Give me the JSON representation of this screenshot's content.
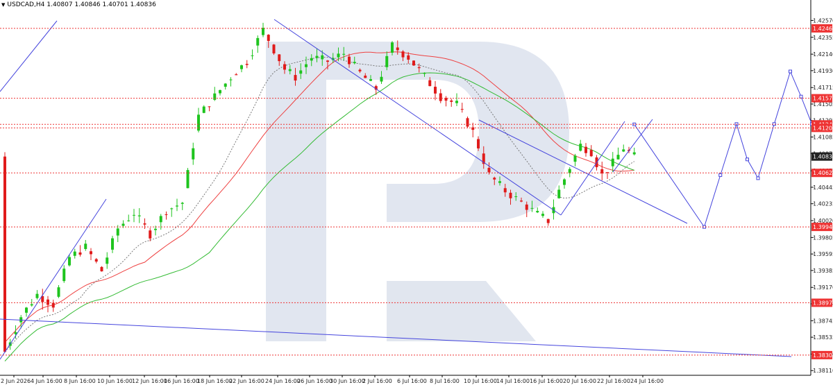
{
  "header": {
    "symbol": "USDCAD,H4",
    "ohlc": "1.40807 1.40846 1.40701 1.40836"
  },
  "colors": {
    "bull": "#1ec41e",
    "bear": "#e01b1b",
    "forecast": "#4444dd",
    "level": "#ee3333",
    "ma_slow": "#ee4040",
    "ma_mid": "#777777",
    "ma_fast": "#33bb33",
    "price_box": "#222222",
    "watermark": "#c9d2e3"
  },
  "chart_data": {
    "type": "candlestick",
    "ylim": [
      1.3805,
      1.4283
    ],
    "y_ticks": [
      "1.42570",
      "1.42355",
      "1.42140",
      "1.41930",
      "1.41715",
      "1.41505",
      "1.41295",
      "1.41085",
      "1.40875",
      "1.40655",
      "1.40445",
      "1.40235",
      "1.40020",
      "1.39805",
      "1.39595",
      "1.39385",
      "1.39170",
      "1.38960",
      "1.38745",
      "1.38535",
      "1.38320",
      "1.38110"
    ],
    "x_ticks": [
      "2 Jun 2026",
      "4 Jun 16:00",
      "8 Jun 16:00",
      "10 Jun 16:00",
      "12 Jun 16:00",
      "16 Jun 16:00",
      "18 Jun 16:00",
      "22 Jun 16:00",
      "24 Jun 16:00",
      "26 Jun 16:00",
      "30 Jun 16:00",
      "2 Jul 16:00",
      "6 Jul 16:00",
      "8 Jul 16:00",
      "10 Jul 16:00",
      "14 Jul 16:00",
      "16 Jul 16:00",
      "20 Jul 16:00",
      "22 Jul 16:00",
      "24 Jul 16:00"
    ],
    "levels": [
      {
        "label": "1.42469",
        "value": 1.42469
      },
      {
        "label": "1.41579",
        "value": 1.41579
      },
      {
        "label": "1.41246",
        "value": 1.41246
      },
      {
        "label": "1.41201",
        "value": 1.41201
      },
      {
        "label": "1.40628",
        "value": 1.40628
      },
      {
        "label": "1.39940",
        "value": 1.3994
      },
      {
        "label": "1.38974",
        "value": 1.38974
      },
      {
        "label": "1.38307",
        "value": 1.38307
      }
    ],
    "current_price": {
      "label": "1.40836",
      "value": 1.40836
    },
    "candles": {
      "x_range": [
        0,
        117
      ],
      "anchors": [
        [
          0,
          1.3835
        ],
        [
          3,
          1.388
        ],
        [
          6,
          1.3908
        ],
        [
          9,
          1.3895
        ],
        [
          12,
          1.3955
        ],
        [
          15,
          1.3968
        ],
        [
          18,
          1.3938
        ],
        [
          21,
          1.3992
        ],
        [
          24,
          1.4012
        ],
        [
          27,
          1.3985
        ],
        [
          30,
          1.4015
        ],
        [
          33,
          1.4025
        ],
        [
          36,
          1.4135
        ],
        [
          39,
          1.416
        ],
        [
          42,
          1.4185
        ],
        [
          45,
          1.4205
        ],
        [
          48,
          1.4245
        ],
        [
          50,
          1.422
        ],
        [
          52,
          1.4195
        ],
        [
          54,
          1.4185
        ],
        [
          57,
          1.421
        ],
        [
          60,
          1.4205
        ],
        [
          63,
          1.4215
        ],
        [
          66,
          1.419
        ],
        [
          69,
          1.417
        ],
        [
          72,
          1.4225
        ],
        [
          75,
          1.421
        ],
        [
          78,
          1.4185
        ],
        [
          81,
          1.416
        ],
        [
          84,
          1.415
        ],
        [
          87,
          1.4115
        ],
        [
          90,
          1.406
        ],
        [
          93,
          1.404
        ],
        [
          96,
          1.4025
        ],
        [
          99,
          1.401
        ],
        [
          101,
          1.4002
        ],
        [
          103,
          1.404
        ],
        [
          105,
          1.407
        ],
        [
          107,
          1.4098
        ],
        [
          109,
          1.409
        ],
        [
          111,
          1.406
        ],
        [
          113,
          1.4075
        ],
        [
          115,
          1.4095
        ],
        [
          117,
          1.40836
        ]
      ]
    },
    "forecast_points": [
      [
        117,
        1.41246
      ],
      [
        130,
        1.3994
      ],
      [
        133,
        1.406
      ],
      [
        136,
        1.4125
      ],
      [
        138,
        1.408
      ],
      [
        140,
        1.4056
      ],
      [
        143,
        1.4125
      ],
      [
        146,
        1.4192
      ],
      [
        148,
        1.416
      ],
      [
        150,
        1.4125
      ]
    ],
    "annotations": "channel lines, trend lines and moving averages drawn over the price series"
  }
}
